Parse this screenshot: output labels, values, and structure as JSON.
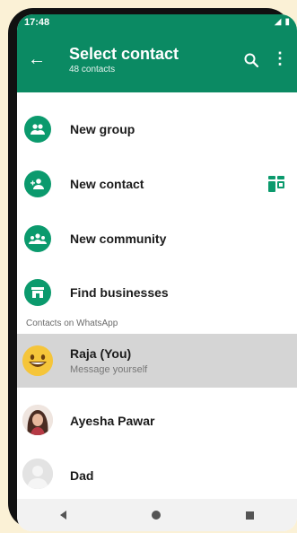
{
  "status": {
    "time": "17:48",
    "signal": "◢",
    "battery": "▮"
  },
  "header": {
    "back_icon": "←",
    "title": "Select contact",
    "subtitle": "48 contacts",
    "more_icon": "⋮"
  },
  "actions": [
    {
      "label": "New group"
    },
    {
      "label": "New contact"
    },
    {
      "label": "New community"
    },
    {
      "label": "Find businesses"
    }
  ],
  "section_label": "Contacts on WhatsApp",
  "contacts": [
    {
      "name": "Raja (You)",
      "status": "Message yourself"
    },
    {
      "name": "Ayesha Pawar",
      "status": ""
    },
    {
      "name": "Dad",
      "status": ""
    }
  ],
  "colors": {
    "brand": "#0b8a63",
    "accent": "#0b9a6d",
    "highlight": "#d5d5d5"
  },
  "icons": {
    "group": "group-icon",
    "add_contact": "add-contact-icon",
    "community": "community-icon",
    "business": "store-icon",
    "qr": "qr-code-icon"
  }
}
